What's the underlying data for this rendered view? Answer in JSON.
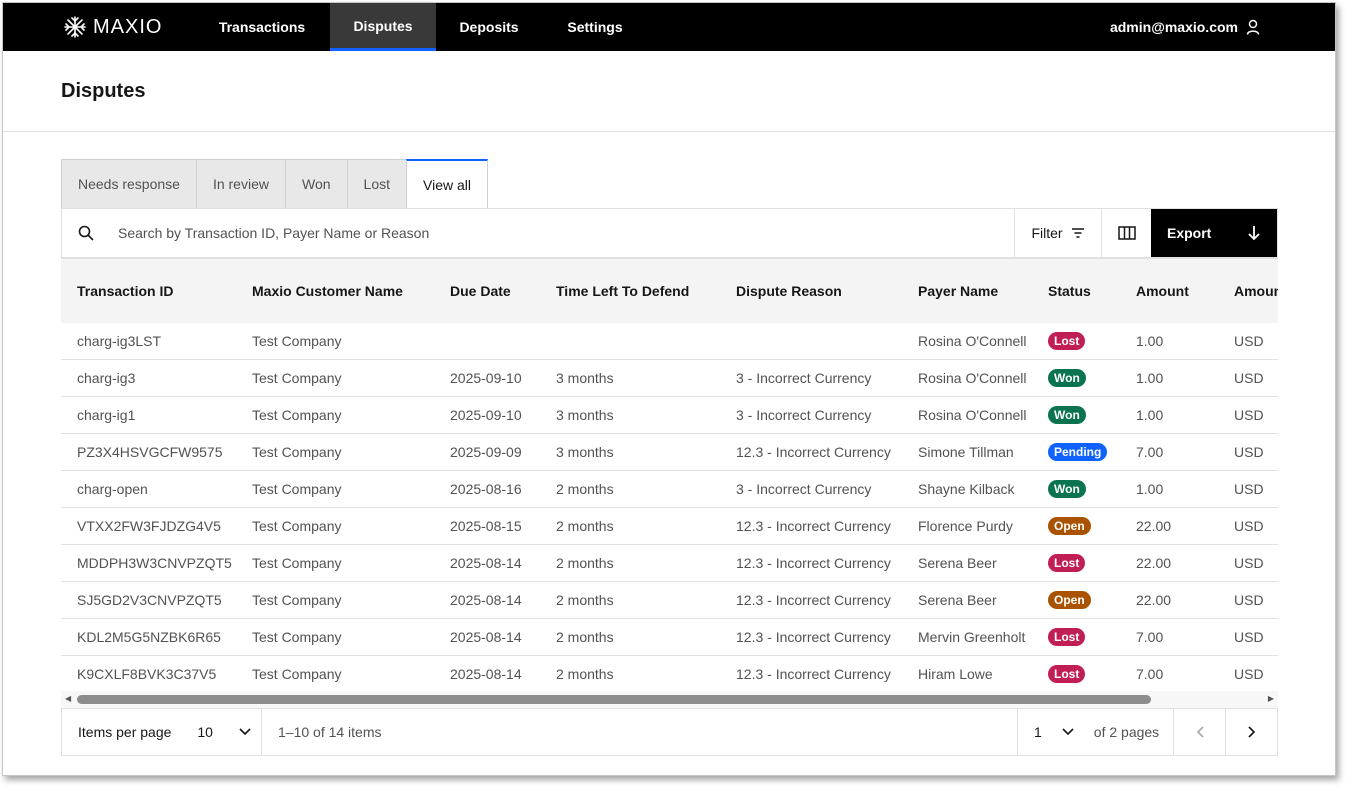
{
  "app": {
    "brand": "MAXIO"
  },
  "nav": {
    "tabs": [
      "Transactions",
      "Disputes",
      "Deposits",
      "Settings"
    ],
    "active": "Disputes",
    "user_email": "admin@maxio.com"
  },
  "page": {
    "title": "Disputes"
  },
  "status_tabs": [
    "Needs response",
    "In review",
    "Won",
    "Lost",
    "View all"
  ],
  "active_status_tab": "View all",
  "toolbar": {
    "search_placeholder": "Search by Transaction ID, Payer Name or Reason",
    "filter_label": "Filter",
    "export_label": "Export"
  },
  "table": {
    "columns": [
      "Transaction ID",
      "Maxio Customer Name",
      "Due Date",
      "Time Left To Defend",
      "Dispute Reason",
      "Payer Name",
      "Status",
      "Amount",
      "Amount"
    ],
    "rows": [
      [
        "charg-ig3LST",
        "Test Company",
        "",
        "",
        "",
        "Rosina O'Connell",
        "Lost",
        "1.00",
        "USD"
      ],
      [
        "charg-ig3",
        "Test Company",
        "2025-09-10",
        "3 months",
        "3 - Incorrect Currency",
        "Rosina O'Connell",
        "Won",
        "1.00",
        "USD"
      ],
      [
        "charg-ig1",
        "Test Company",
        "2025-09-10",
        "3 months",
        "3 - Incorrect Currency",
        "Rosina O'Connell",
        "Won",
        "1.00",
        "USD"
      ],
      [
        "PZ3X4HSVGCFW9575",
        "Test Company",
        "2025-09-09",
        "3 months",
        "12.3 - Incorrect Currency",
        "Simone Tillman",
        "Pending",
        "7.00",
        "USD"
      ],
      [
        "charg-open",
        "Test Company",
        "2025-08-16",
        "2 months",
        "3 - Incorrect Currency",
        "Shayne Kilback",
        "Won",
        "1.00",
        "USD"
      ],
      [
        "VTXX2FW3FJDZG4V5",
        "Test Company",
        "2025-08-15",
        "2 months",
        "12.3 - Incorrect Currency",
        "Florence Purdy",
        "Open",
        "22.00",
        "USD"
      ],
      [
        "MDDPH3W3CNVPZQT5",
        "Test Company",
        "2025-08-14",
        "2 months",
        "12.3 - Incorrect Currency",
        "Serena Beer",
        "Lost",
        "22.00",
        "USD"
      ],
      [
        "SJ5GD2V3CNVPZQT5",
        "Test Company",
        "2025-08-14",
        "2 months",
        "12.3 - Incorrect Currency",
        "Serena Beer",
        "Open",
        "22.00",
        "USD"
      ],
      [
        "KDL2M5G5NZBK6R65",
        "Test Company",
        "2025-08-14",
        "2 months",
        "12.3 - Incorrect Currency",
        "Mervin Greenholt",
        "Lost",
        "7.00",
        "USD"
      ],
      [
        "K9CXLF8BVK3C37V5",
        "Test Company",
        "2025-08-14",
        "2 months",
        "12.3 - Incorrect Currency",
        "Hiram Lowe",
        "Lost",
        "7.00",
        "USD"
      ]
    ]
  },
  "status_colors": {
    "Lost": "#c21e56",
    "Won": "#0a7350",
    "Pending": "#0f62fe",
    "Open": "#a95300"
  },
  "pagination": {
    "items_per_page_label": "Items per page",
    "items_per_page": "10",
    "range_text": "1–10 of 14 items",
    "current_page": "1",
    "of_pages": "of 2 pages"
  },
  "icons": {
    "logo": "snowflake-icon",
    "user": "user-icon",
    "search": "search-icon",
    "filter": "filter-icon",
    "columns": "columns-icon",
    "export": "arrow-down-icon"
  }
}
